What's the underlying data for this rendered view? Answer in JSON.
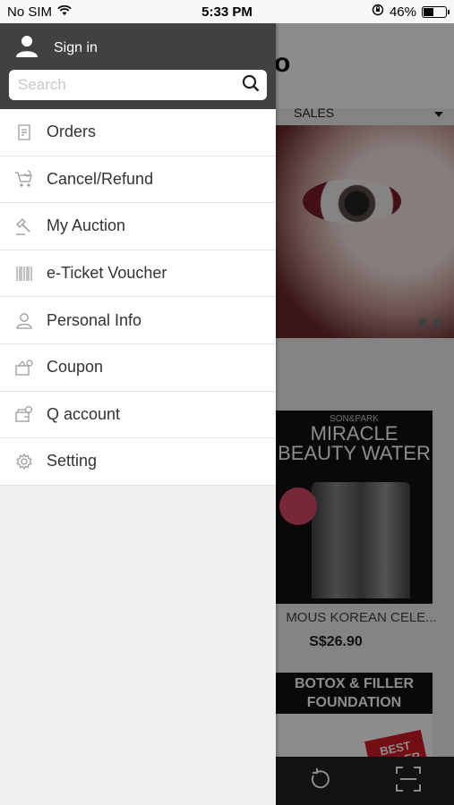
{
  "status_bar": {
    "carrier": "No SIM",
    "time": "5:33 PM",
    "battery_text": "46%",
    "battery_level": 0.46
  },
  "drawer": {
    "sign_in_label": "Sign in",
    "search": {
      "placeholder": "Search",
      "value": ""
    },
    "menu": [
      {
        "label": "Orders",
        "icon": "orders-icon"
      },
      {
        "label": "Cancel/Refund",
        "icon": "cart-refund-icon"
      },
      {
        "label": "My Auction",
        "icon": "gavel-icon"
      },
      {
        "label": "e-Ticket Voucher",
        "icon": "barcode-icon"
      },
      {
        "label": "Personal Info",
        "icon": "person-icon"
      },
      {
        "label": "Coupon",
        "icon": "coupon-icon"
      },
      {
        "label": "Q account",
        "icon": "wallet-icon"
      },
      {
        "label": "Setting",
        "icon": "gear-icon"
      }
    ]
  },
  "background_app": {
    "category_label": "SALES",
    "product_1": {
      "brand_text": "SON&PARK",
      "image_title": "MIRACLE BEAUTY WATER",
      "name": "MOUS KOREAN CELE...",
      "price": "S$26.90"
    },
    "product_2": {
      "header": "BOTOX & FILLER FOUNDATION",
      "badge_line1": "BEST",
      "badge_line2": "SELLER"
    }
  },
  "colors": {
    "drawer_header": "#414141",
    "drawer_bg": "#eff0f2",
    "menu_text": "#333333"
  }
}
